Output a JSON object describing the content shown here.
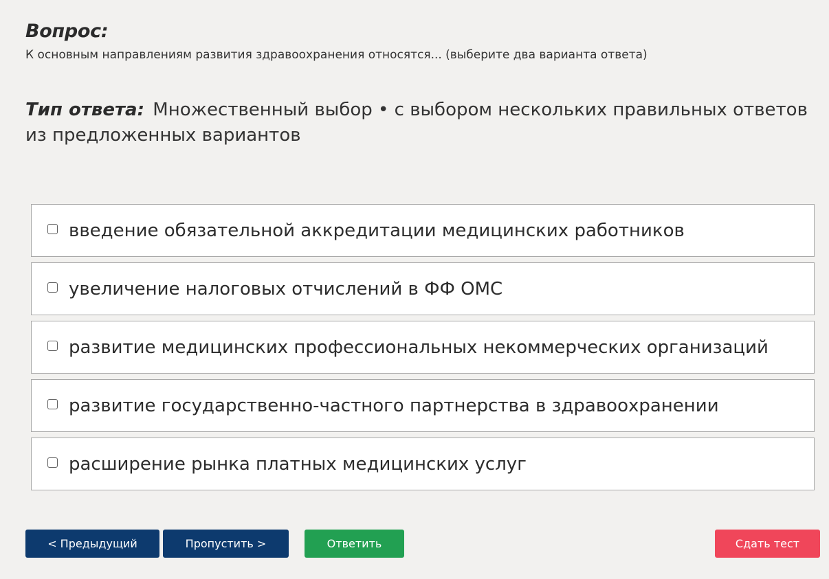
{
  "question": {
    "heading": "Вопрос:",
    "text": "К основным направлениям развития здравоохранения относятся... (выберите два варианта ответа)"
  },
  "answer_type": {
    "label": "Тип ответа:",
    "value": "Множественный выбор • с выбором нескольких правильных ответов из предложенных вариантов"
  },
  "options": [
    {
      "label": "введение обязательной аккредитации медицинских работников",
      "checked": false
    },
    {
      "label": "увеличение налоговых отчислений в ФФ ОМС",
      "checked": false
    },
    {
      "label": "развитие медицинских профессиональных некоммерческих организаций",
      "checked": false
    },
    {
      "label": "развитие государственно-частного партнерства в здравоохранении",
      "checked": false
    },
    {
      "label": "расширение рынка платных медицинских услуг",
      "checked": false
    }
  ],
  "buttons": {
    "prev": "< Предыдущий",
    "skip": "Пропустить >",
    "answer": "Ответить",
    "submit": "Сдать тест"
  },
  "colors": {
    "background": "#f2f1ef",
    "nav_button": "#0d3a6e",
    "answer_button": "#22a052",
    "submit_button": "#f0465a"
  }
}
